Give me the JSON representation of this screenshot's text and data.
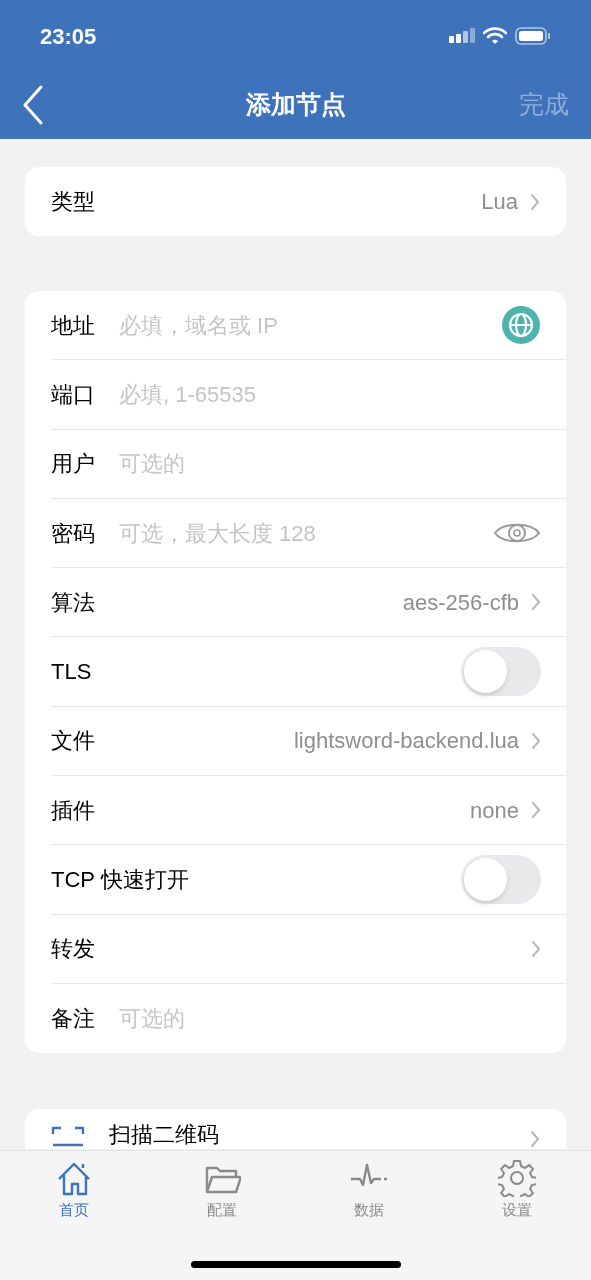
{
  "status_bar": {
    "time": "23:05"
  },
  "nav": {
    "title": "添加节点",
    "done": {
      "label": "完成",
      "disabled": true
    }
  },
  "type_row": {
    "label": "类型",
    "value": "Lua"
  },
  "rows": [
    {
      "kind": "address",
      "label": "地址",
      "placeholder": "必填，域名或 IP"
    },
    {
      "kind": "field",
      "label": "端口",
      "placeholder": "必填, 1-65535"
    },
    {
      "kind": "field",
      "label": "用户",
      "placeholder": "可选的"
    },
    {
      "kind": "password",
      "label": "密码",
      "placeholder": "可选，最大长度 128"
    },
    {
      "kind": "select",
      "label": "算法",
      "value": "aes-256-cfb"
    },
    {
      "kind": "switch",
      "label": "TLS",
      "on": false
    },
    {
      "kind": "select",
      "label": "文件",
      "value": "lightsword-backend.lua"
    },
    {
      "kind": "select",
      "label": "插件",
      "value": "none"
    },
    {
      "kind": "switch",
      "label": "TCP 快速打开",
      "on": false
    },
    {
      "kind": "select",
      "label": "转发"
    },
    {
      "kind": "field",
      "label": "备注",
      "placeholder": "可选的"
    }
  ],
  "scan_row": {
    "label": "扫描二维码"
  },
  "tabs": [
    {
      "kind": "home",
      "label": "首页",
      "selected": true
    },
    {
      "kind": "folder",
      "label": "配置",
      "selected": false
    },
    {
      "kind": "pulse",
      "label": "数据",
      "selected": false
    },
    {
      "kind": "gear",
      "label": "设置",
      "selected": false
    }
  ]
}
